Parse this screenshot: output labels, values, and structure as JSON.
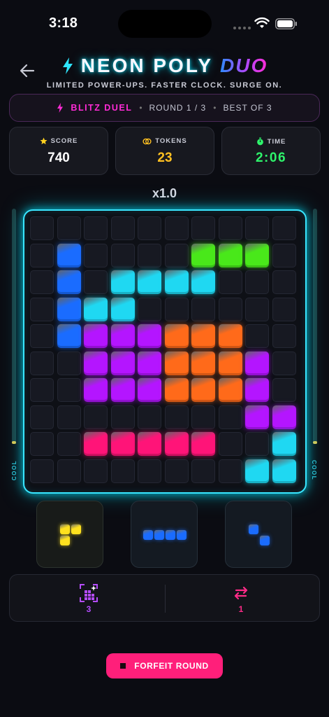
{
  "status_bar": {
    "time": "3:18"
  },
  "header": {
    "title": "NEON POLY",
    "title_accent": "DUO",
    "subtitle": "LIMITED POWER-UPS. FASTER CLOCK. SURGE ON."
  },
  "match": {
    "mode": "BLITZ DUEL",
    "separator": "•",
    "round": "ROUND 1 / 3",
    "best_of": "BEST OF 3"
  },
  "stats": {
    "score": {
      "label": "SCORE",
      "value": "740",
      "icon": "star-icon"
    },
    "tokens": {
      "label": "TOKENS",
      "value": "23",
      "icon": "coins-icon"
    },
    "time": {
      "label": "TIME",
      "value": "2:06",
      "icon": "stopwatch-icon"
    }
  },
  "multiplier": "x1.0",
  "meters": {
    "left_label": "COOL",
    "right_label": "COOL",
    "left_level": 0.0,
    "right_level": 0.0
  },
  "colors": {
    "B": "#1a6cff",
    "C": "#1fd8f2",
    "G": "#49e81a",
    "P": "#b415ff",
    "O": "#ff6a1a",
    "M": "#ff1478",
    "Y": "#ffe11f",
    "accent": "#39e6ff",
    "forfeit": "#ff1f7a"
  },
  "board": {
    "size": 10,
    "rows": [
      "..........",
      ".B....GGG.",
      ".B.CCCC...",
      ".BCC......",
      ".BPPPOOO..",
      "..PPPOOOP.",
      "..PPPOOOP.",
      "........PP",
      "..MMMMM..CC",
      "........CC."
    ]
  },
  "tray": [
    {
      "name": "tray-piece-yellow",
      "color": "Y",
      "cells": [
        [
          0,
          0
        ],
        [
          0,
          1
        ],
        [
          1,
          0
        ]
      ]
    },
    {
      "name": "tray-piece-blue-bar",
      "color": "B",
      "cells": [
        [
          0,
          0
        ],
        [
          0,
          1
        ],
        [
          0,
          2
        ],
        [
          0,
          3
        ]
      ]
    },
    {
      "name": "tray-piece-blue-diagonal",
      "color": "B",
      "cells": [
        [
          0,
          0
        ],
        [
          1,
          1
        ]
      ]
    }
  ],
  "powerups": [
    {
      "name": "grid-bomb",
      "icon": "grid-sparkle-icon",
      "count": "3"
    },
    {
      "name": "swap",
      "icon": "swap-arrows-icon",
      "count": "1"
    }
  ],
  "forfeit": {
    "label": "FORFEIT ROUND"
  }
}
